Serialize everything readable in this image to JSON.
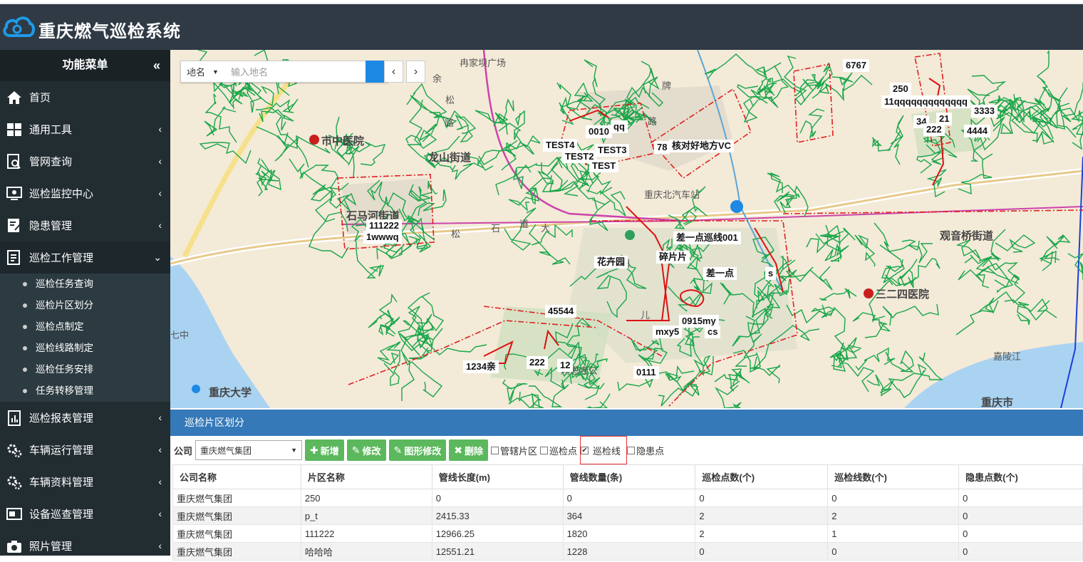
{
  "app": {
    "title": "重庆燃气巡检系统"
  },
  "sidebar": {
    "header": "功能菜单",
    "collapse_icon": "«",
    "items": [
      {
        "label": "首页",
        "icon": "home-icon",
        "arrow": ""
      },
      {
        "label": "通用工具",
        "icon": "grid-icon",
        "arrow": "‹"
      },
      {
        "label": "管网查询",
        "icon": "search-doc-icon",
        "arrow": "‹"
      },
      {
        "label": "巡检监控中心",
        "icon": "monitor-icon",
        "arrow": "‹"
      },
      {
        "label": "隐患管理",
        "icon": "edit-doc-icon",
        "arrow": "‹"
      },
      {
        "label": "巡检工作管理",
        "icon": "list-doc-icon",
        "arrow": "⌄"
      }
    ],
    "sub_items": [
      "巡检任务查询",
      "巡检片区划分",
      "巡检点制定",
      "巡检线路制定",
      "巡检任务安排",
      "任务转移管理"
    ],
    "items_after": [
      {
        "label": "巡检报表管理",
        "icon": "report-icon",
        "arrow": "‹"
      },
      {
        "label": "车辆运行管理",
        "icon": "gears-icon",
        "arrow": "‹"
      },
      {
        "label": "车辆资料管理",
        "icon": "gears-icon",
        "arrow": "‹"
      },
      {
        "label": "设备巡查管理",
        "icon": "device-icon",
        "arrow": "‹"
      },
      {
        "label": "照片管理",
        "icon": "camera-icon",
        "arrow": "‹"
      }
    ]
  },
  "map": {
    "search": {
      "type": "地名",
      "placeholder": "输入地名"
    },
    "places": [
      "冉家坝广场",
      "市中医院",
      "龙山街道",
      "石马河街道",
      "松",
      "石",
      "大",
      "道",
      "花卉园",
      "观音桥街道",
      "三二四医院",
      "重庆大学",
      "七中",
      "重庆北汽车站",
      "鸿恩寺公",
      "嘉陵江",
      "重庆市",
      "余",
      "松",
      "路",
      "牌",
      "路",
      "儿"
    ],
    "labels": [
      "6767",
      "250",
      "3333",
      "4444",
      "11qqqqqqqqqqqqq",
      "34",
      "21",
      "222",
      "0010",
      "qq",
      "TEST4",
      "TEST3",
      "TEST2",
      "TEST",
      "78",
      "核对好地方VC",
      "111222",
      "1wwwq",
      "差一点巡线001",
      "碎片片",
      "花卉园",
      "差一点",
      "s",
      "45544",
      "0915my",
      "mxy5",
      "cs",
      "1234亲",
      "222",
      "12",
      "0111"
    ]
  },
  "panel": {
    "title": "巡检片区划分"
  },
  "toolbar": {
    "company_label": "公司",
    "company_value": "重庆燃气集团",
    "buttons": [
      {
        "label": "新增",
        "icon": "plus-icon"
      },
      {
        "label": "修改",
        "icon": "pencil-icon"
      },
      {
        "label": "图形修改",
        "icon": "pencil-icon"
      },
      {
        "label": "删除",
        "icon": "x-icon"
      }
    ],
    "checkboxes": [
      {
        "label": "管辖片区",
        "checked": false
      },
      {
        "label": "巡检点",
        "checked": false
      },
      {
        "label": "巡检线",
        "checked": true
      },
      {
        "label": "隐患点",
        "checked": false
      }
    ]
  },
  "table": {
    "columns": [
      "公司名称",
      "片区名称",
      "管线长度(m)",
      "管线数量(条)",
      "巡检点数(个)",
      "巡检线数(个)",
      "隐患点数(个)"
    ],
    "rows": [
      [
        "重庆燃气集团",
        "250",
        "0",
        "0",
        "0",
        "0",
        "0"
      ],
      [
        "重庆燃气集团",
        "p_t",
        "2415.33",
        "364",
        "2",
        "2",
        "0"
      ],
      [
        "重庆燃气集团",
        "111222",
        "12966.25",
        "1820",
        "2",
        "1",
        "0"
      ],
      [
        "重庆燃气集团",
        "哈哈哈",
        "12551.21",
        "1228",
        "0",
        "0",
        "0"
      ]
    ]
  },
  "colors": {
    "header": "#2f3a45",
    "sidebar": "#222d32",
    "panel": "#3579b8",
    "button": "#5cb85c",
    "pipe": "#1aa64a",
    "zone": "#e02020"
  }
}
